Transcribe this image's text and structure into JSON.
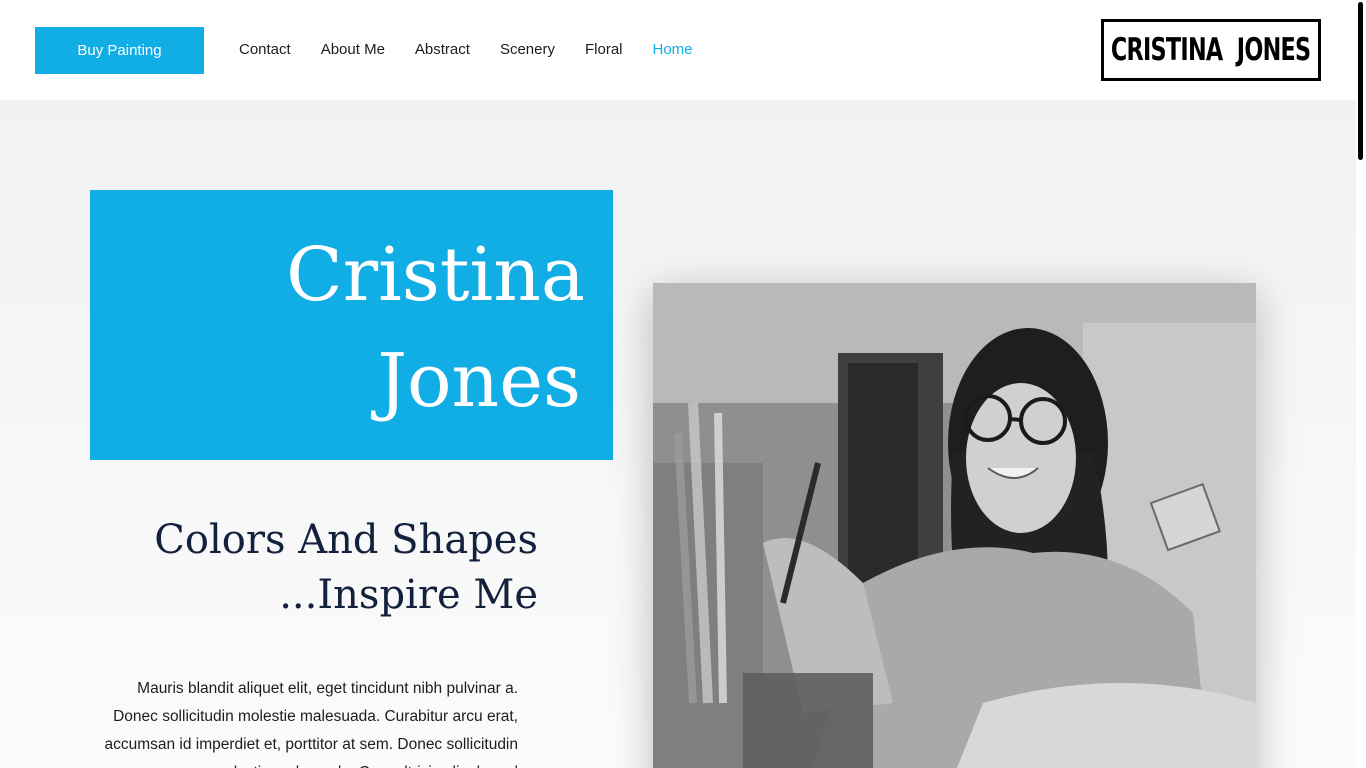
{
  "header": {
    "buy_button": "Buy Painting",
    "nav": [
      {
        "label": "Contact",
        "active": false
      },
      {
        "label": "About Me",
        "active": false
      },
      {
        "label": "Abstract",
        "active": false
      },
      {
        "label": "Scenery",
        "active": false
      },
      {
        "label": "Floral",
        "active": false
      },
      {
        "label": "Home",
        "active": true
      }
    ],
    "logo_text": "CRISTINA JONES"
  },
  "hero": {
    "name_line1": "Cristina",
    "name_line2": "Jones",
    "tagline_line1": "Colors And Shapes",
    "tagline_line2": "...Inspire Me",
    "body_text": "Mauris blandit aliquet elit, eget tincidunt nibh pulvinar a. Donec sollicitudin molestie malesuada. Curabitur arcu erat, accumsan id imperdiet et, porttitor at sem. Donec sollicitudin molestie malesuada. Cras ultricies ligula sed"
  },
  "colors": {
    "accent": "#10aee4",
    "heading": "#14213d",
    "text": "#1d1d1d"
  }
}
